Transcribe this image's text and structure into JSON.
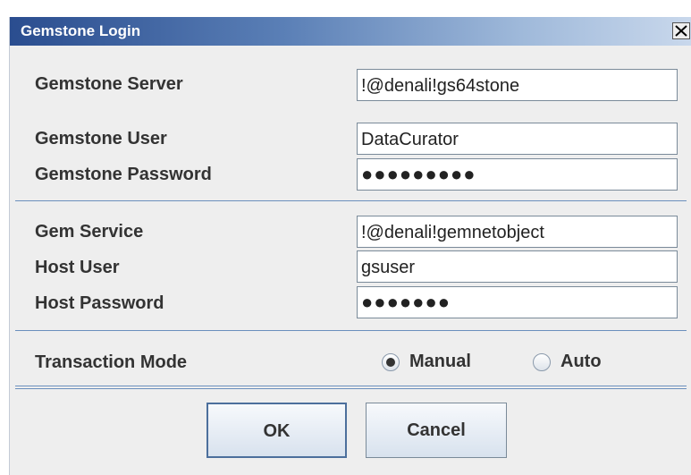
{
  "window": {
    "title": "Gemstone Login",
    "close_label": "X"
  },
  "form": {
    "server_label": "Gemstone Server",
    "server_value": "!@denali!gs64stone",
    "user_label": "Gemstone User",
    "user_value": "DataCurator",
    "password_label": "Gemstone Password",
    "password_mask": "●●●●●●●●●",
    "gem_service_label": "Gem Service",
    "gem_service_value": "!@denali!gemnetobject",
    "host_user_label": "Host User",
    "host_user_value": "gsuser",
    "host_password_label": "Host Password",
    "host_password_mask": "●●●●●●●"
  },
  "transaction": {
    "label": "Transaction Mode",
    "options": [
      "Manual",
      "Auto"
    ],
    "selected": "Manual"
  },
  "buttons": {
    "ok": "OK",
    "cancel": "Cancel"
  },
  "colors": {
    "titlebar_start": "#2a4d8f",
    "separator": "#6b8fbd",
    "panel_bg": "#eeeeee"
  }
}
